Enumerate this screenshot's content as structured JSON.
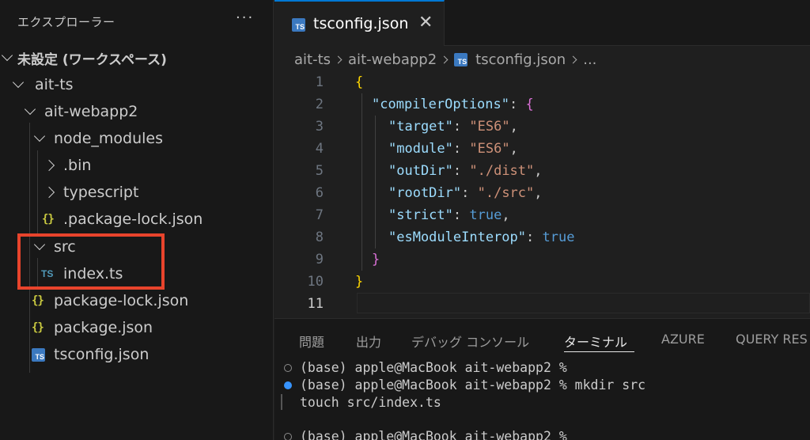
{
  "explorer": {
    "title": "エクスプローラー",
    "more": "···",
    "workspace": "未設定 (ワークスペース)",
    "items": [
      {
        "label": "ait-ts",
        "kind": "folder"
      },
      {
        "label": "ait-webapp2",
        "kind": "folder"
      },
      {
        "label": "node_modules",
        "kind": "folder"
      },
      {
        "label": ".bin",
        "kind": "folder-collapsed"
      },
      {
        "label": "typescript",
        "kind": "folder-collapsed"
      },
      {
        "label": ".package-lock.json",
        "kind": "json"
      },
      {
        "label": "src",
        "kind": "folder"
      },
      {
        "label": "index.ts",
        "kind": "ts"
      },
      {
        "label": "package-lock.json",
        "kind": "json"
      },
      {
        "label": "package.json",
        "kind": "json"
      },
      {
        "label": "tsconfig.json",
        "kind": "ts-config"
      }
    ],
    "json_icon": "{}",
    "ts_icon": "TS"
  },
  "editor": {
    "tab_title": "tsconfig.json",
    "tab_close": "✕",
    "tab_icon": "TS",
    "breadcrumb": [
      "ait-ts",
      "ait-webapp2",
      "tsconfig.json",
      "..."
    ],
    "line_numbers": [
      "1",
      "2",
      "3",
      "4",
      "5",
      "6",
      "7",
      "8",
      "9",
      "10",
      "11"
    ],
    "code": {
      "l1": "{",
      "l2_key": "\"compilerOptions\"",
      "l2_open": "{",
      "l3_key": "\"target\"",
      "l3_val": "\"ES6\"",
      "l4_key": "\"module\"",
      "l4_val": "\"ES6\"",
      "l5_key": "\"outDir\"",
      "l5_val": "\"./dist\"",
      "l6_key": "\"rootDir\"",
      "l6_val": "\"./src\"",
      "l7_key": "\"strict\"",
      "l7_val": "true",
      "l8_key": "\"esModuleInterop\"",
      "l8_val": "true",
      "l9": "}",
      "l10": "}"
    }
  },
  "panel": {
    "tabs": [
      "問題",
      "出力",
      "デバッグ コンソール",
      "ターミナル",
      "AZURE",
      "QUERY RES"
    ],
    "active_tab": "ターミナル",
    "terminal": [
      "(base) apple@MacBook ait-webapp2 %",
      "(base) apple@MacBook ait-webapp2 % mkdir src",
      "touch src/index.ts",
      "",
      "(base) apple@MacBook ait-webapp2 %"
    ]
  },
  "colors": {
    "accent": "#0078d4",
    "highlight_box": "#e8442c",
    "json_icon": "#cbcb41",
    "ts_icon": "#519aba"
  }
}
